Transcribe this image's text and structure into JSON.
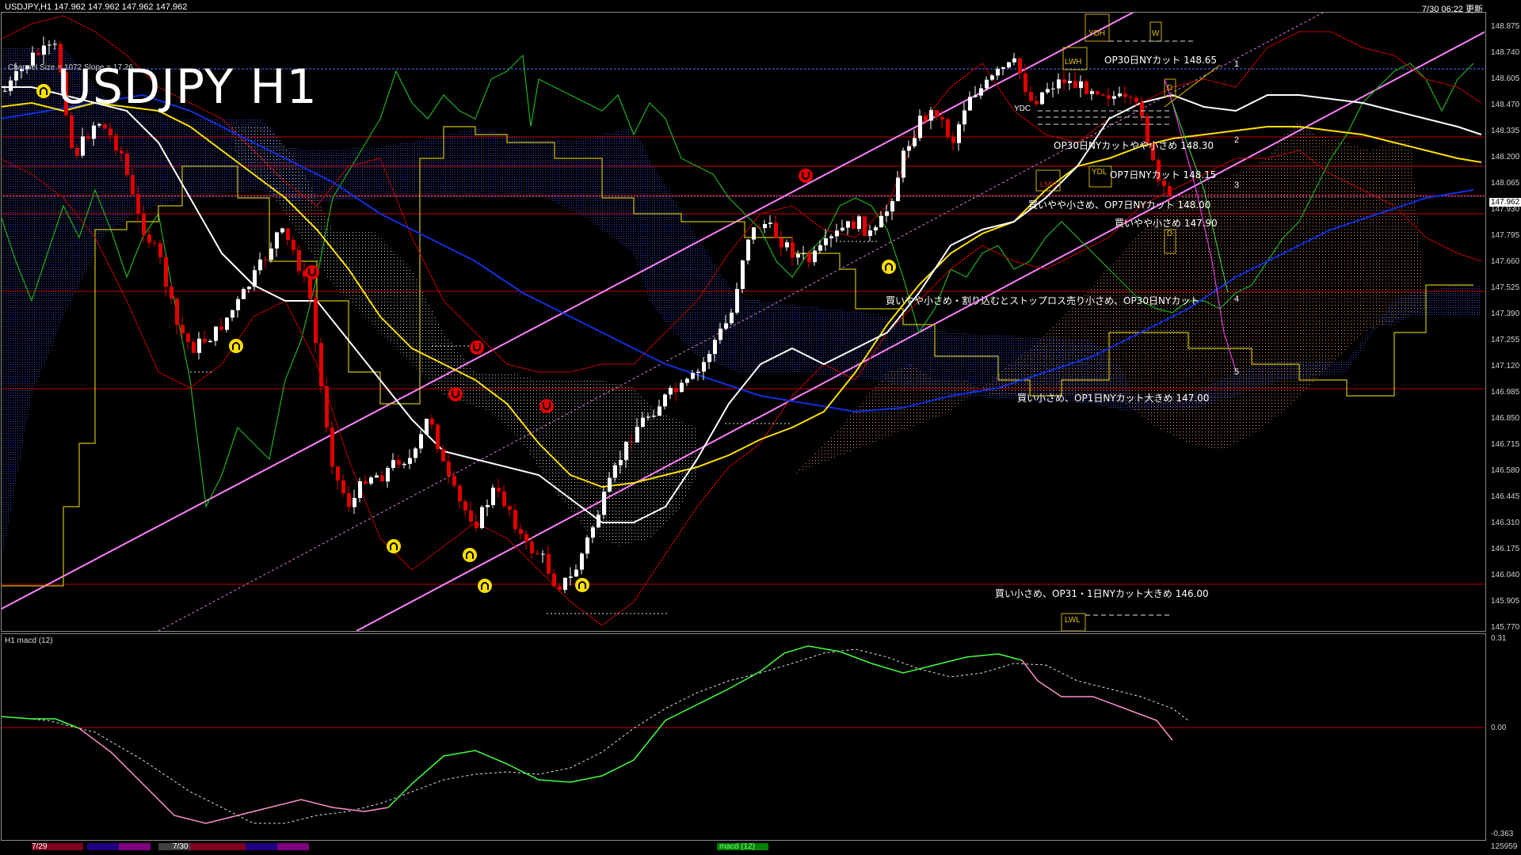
{
  "header": {
    "left": "USDJPY,H1  147.962 147.962 147.962 147.962",
    "right": "7/30 06:22 更新"
  },
  "title": "USDJPY H1",
  "channel_info": "Channel Size = 1072 Slope = 17.26",
  "macd_label": "H1  macd (12)",
  "annotations": [
    "OP30日NYカット 148.65",
    "OP30日NYカットやや小さめ 148.30",
    "OP7日NYカット 148.15",
    "買いやや小さめ、OP7日NYカット 148.00",
    "買いやや小さめ 147.90",
    "買いやや小さめ・割り込むとストップロス売り小さめ、OP30日NYカット",
    "買い小さめ、OP1日NYカット大きめ 147.00",
    "買い小さめ、OP31・1日NYカット大きめ 146.00"
  ],
  "target_numbers": [
    "1",
    "2",
    "3",
    "4",
    "5"
  ],
  "price_axis": [
    "148.875",
    "148.740",
    "148.605",
    "148.470",
    "148.335",
    "148.200",
    "148.065",
    "147.930",
    "147.795",
    "147.660",
    "147.525",
    "147.390",
    "147.255",
    "147.120",
    "146.985",
    "146.850",
    "146.715",
    "146.580",
    "146.445",
    "146.310",
    "146.175",
    "146.040",
    "145.905",
    "145.770"
  ],
  "current_price": "147.962",
  "macd_axis": [
    "0.31",
    "0.00",
    "-0.363"
  ],
  "level_boxes": [
    "YDH",
    "W",
    "LWH",
    "D",
    "YDC",
    "YDL",
    "LMH",
    "D",
    "LWL"
  ],
  "time_labels": [
    "7/29",
    "7/30"
  ],
  "bottom_value": "125959",
  "macd_tab": "macd (12)",
  "colors": {
    "background": "#000000",
    "red_line": "#c00000",
    "pink_channel": "#ff80ff",
    "yellow": "#ffff00",
    "white": "#ffffff",
    "blue_cloud": "#2030a0",
    "orange_cloud": "#e0a070",
    "green": "#00cc00",
    "macd_green": "#40ff40",
    "macd_pink": "#ff80c0"
  },
  "icons": [
    "up-fractal-icon",
    "down-fractal-icon"
  ]
}
